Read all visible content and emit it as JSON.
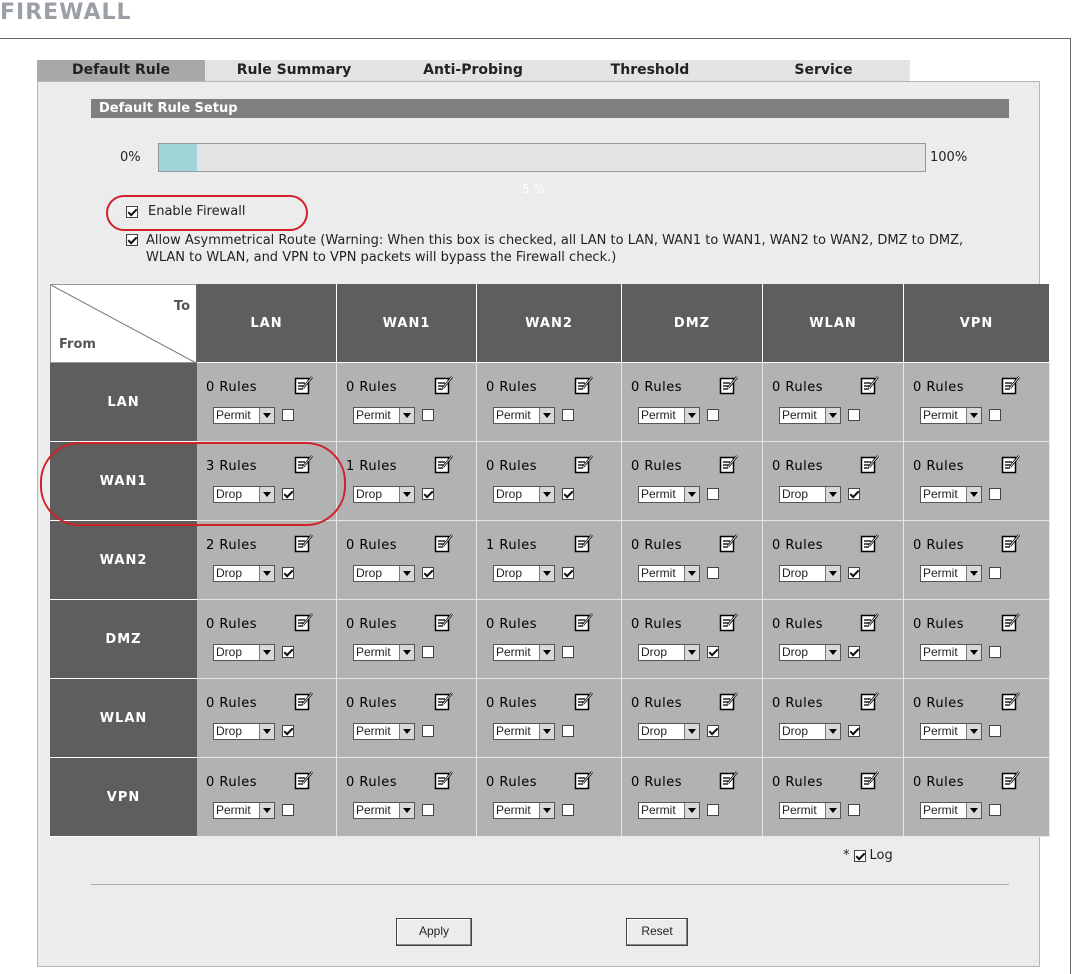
{
  "page_title": "FIREWALL",
  "tabs": [
    {
      "label": "Default Rule",
      "active": true
    },
    {
      "label": "Rule Summary",
      "active": false
    },
    {
      "label": "Anti-Probing",
      "active": false
    },
    {
      "label": "Threshold",
      "active": false
    },
    {
      "label": "Service",
      "active": false
    }
  ],
  "section_title": "Default Rule Setup",
  "progress": {
    "left_label": "0%",
    "right_label": "100%",
    "value_label": "5 %",
    "value_fraction": 0.05
  },
  "options": {
    "enable_firewall": {
      "label": "Enable Firewall",
      "checked": true
    },
    "allow_asymmetrical": {
      "label": "Allow Asymmetrical Route (Warning: When this box is checked, all LAN to LAN, WAN1 to WAN1, WAN2 to WAN2, DMZ to DMZ, WLAN to WLAN, and VPN to VPN packets will bypass the Firewall check.)",
      "checked": true
    }
  },
  "matrix": {
    "to_label": "To",
    "from_label": "From",
    "columns": [
      "LAN",
      "WAN1",
      "WAN2",
      "DMZ",
      "WLAN",
      "VPN"
    ],
    "rows": [
      {
        "name": "LAN",
        "cells": [
          {
            "rules": "0 Rules",
            "action": "Permit",
            "log": false
          },
          {
            "rules": "0 Rules",
            "action": "Permit",
            "log": false
          },
          {
            "rules": "0 Rules",
            "action": "Permit",
            "log": false
          },
          {
            "rules": "0 Rules",
            "action": "Permit",
            "log": false
          },
          {
            "rules": "0 Rules",
            "action": "Permit",
            "log": false
          },
          {
            "rules": "0 Rules",
            "action": "Permit",
            "log": false
          }
        ]
      },
      {
        "name": "WAN1",
        "cells": [
          {
            "rules": "3 Rules",
            "action": "Drop",
            "log": true
          },
          {
            "rules": "1 Rules",
            "action": "Drop",
            "log": true
          },
          {
            "rules": "0 Rules",
            "action": "Drop",
            "log": true
          },
          {
            "rules": "0 Rules",
            "action": "Permit",
            "log": false
          },
          {
            "rules": "0 Rules",
            "action": "Drop",
            "log": true
          },
          {
            "rules": "0 Rules",
            "action": "Permit",
            "log": false
          }
        ]
      },
      {
        "name": "WAN2",
        "cells": [
          {
            "rules": "2 Rules",
            "action": "Drop",
            "log": true
          },
          {
            "rules": "0 Rules",
            "action": "Drop",
            "log": true
          },
          {
            "rules": "1 Rules",
            "action": "Drop",
            "log": true
          },
          {
            "rules": "0 Rules",
            "action": "Permit",
            "log": false
          },
          {
            "rules": "0 Rules",
            "action": "Drop",
            "log": true
          },
          {
            "rules": "0 Rules",
            "action": "Permit",
            "log": false
          }
        ]
      },
      {
        "name": "DMZ",
        "cells": [
          {
            "rules": "0 Rules",
            "action": "Drop",
            "log": true
          },
          {
            "rules": "0 Rules",
            "action": "Permit",
            "log": false
          },
          {
            "rules": "0 Rules",
            "action": "Permit",
            "log": false
          },
          {
            "rules": "0 Rules",
            "action": "Drop",
            "log": true
          },
          {
            "rules": "0 Rules",
            "action": "Drop",
            "log": true
          },
          {
            "rules": "0 Rules",
            "action": "Permit",
            "log": false
          }
        ]
      },
      {
        "name": "WLAN",
        "cells": [
          {
            "rules": "0 Rules",
            "action": "Drop",
            "log": true
          },
          {
            "rules": "0 Rules",
            "action": "Permit",
            "log": false
          },
          {
            "rules": "0 Rules",
            "action": "Permit",
            "log": false
          },
          {
            "rules": "0 Rules",
            "action": "Drop",
            "log": true
          },
          {
            "rules": "0 Rules",
            "action": "Drop",
            "log": true
          },
          {
            "rules": "0 Rules",
            "action": "Permit",
            "log": false
          }
        ]
      },
      {
        "name": "VPN",
        "cells": [
          {
            "rules": "0 Rules",
            "action": "Permit",
            "log": false
          },
          {
            "rules": "0 Rules",
            "action": "Permit",
            "log": false
          },
          {
            "rules": "0 Rules",
            "action": "Permit",
            "log": false
          },
          {
            "rules": "0 Rules",
            "action": "Permit",
            "log": false
          },
          {
            "rules": "0 Rules",
            "action": "Permit",
            "log": false
          },
          {
            "rules": "0 Rules",
            "action": "Permit",
            "log": false
          }
        ]
      }
    ],
    "edit_icon": "edit-icon"
  },
  "log_legend": {
    "prefix": "*",
    "label": "Log",
    "checked": true
  },
  "buttons": {
    "apply": "Apply",
    "reset": "Reset"
  },
  "colors": {
    "header_bg": "#5e5e5e",
    "cell_bg": "#b2b2b2",
    "progress_fill": "#9fd4d6",
    "highlight": "#d0202a"
  }
}
